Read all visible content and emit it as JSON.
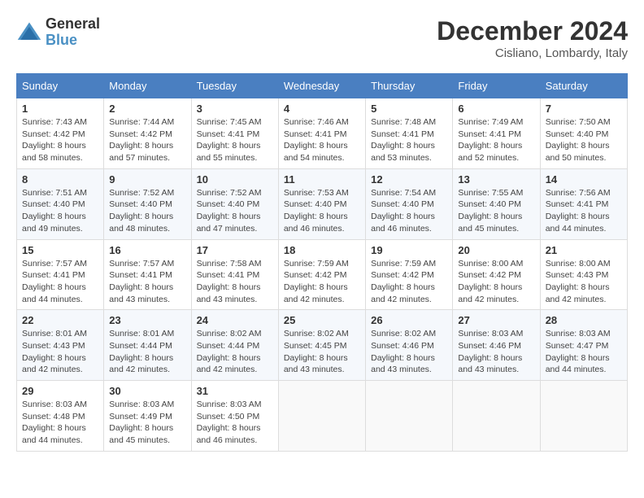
{
  "header": {
    "logo_general": "General",
    "logo_blue": "Blue",
    "title": "December 2024",
    "location": "Cisliano, Lombardy, Italy"
  },
  "calendar": {
    "days_of_week": [
      "Sunday",
      "Monday",
      "Tuesday",
      "Wednesday",
      "Thursday",
      "Friday",
      "Saturday"
    ],
    "weeks": [
      [
        {
          "day": "1",
          "sunrise": "7:43 AM",
          "sunset": "4:42 PM",
          "daylight": "8 hours and 58 minutes."
        },
        {
          "day": "2",
          "sunrise": "7:44 AM",
          "sunset": "4:42 PM",
          "daylight": "8 hours and 57 minutes."
        },
        {
          "day": "3",
          "sunrise": "7:45 AM",
          "sunset": "4:41 PM",
          "daylight": "8 hours and 55 minutes."
        },
        {
          "day": "4",
          "sunrise": "7:46 AM",
          "sunset": "4:41 PM",
          "daylight": "8 hours and 54 minutes."
        },
        {
          "day": "5",
          "sunrise": "7:48 AM",
          "sunset": "4:41 PM",
          "daylight": "8 hours and 53 minutes."
        },
        {
          "day": "6",
          "sunrise": "7:49 AM",
          "sunset": "4:41 PM",
          "daylight": "8 hours and 52 minutes."
        },
        {
          "day": "7",
          "sunrise": "7:50 AM",
          "sunset": "4:40 PM",
          "daylight": "8 hours and 50 minutes."
        }
      ],
      [
        {
          "day": "8",
          "sunrise": "7:51 AM",
          "sunset": "4:40 PM",
          "daylight": "8 hours and 49 minutes."
        },
        {
          "day": "9",
          "sunrise": "7:52 AM",
          "sunset": "4:40 PM",
          "daylight": "8 hours and 48 minutes."
        },
        {
          "day": "10",
          "sunrise": "7:52 AM",
          "sunset": "4:40 PM",
          "daylight": "8 hours and 47 minutes."
        },
        {
          "day": "11",
          "sunrise": "7:53 AM",
          "sunset": "4:40 PM",
          "daylight": "8 hours and 46 minutes."
        },
        {
          "day": "12",
          "sunrise": "7:54 AM",
          "sunset": "4:40 PM",
          "daylight": "8 hours and 46 minutes."
        },
        {
          "day": "13",
          "sunrise": "7:55 AM",
          "sunset": "4:40 PM",
          "daylight": "8 hours and 45 minutes."
        },
        {
          "day": "14",
          "sunrise": "7:56 AM",
          "sunset": "4:41 PM",
          "daylight": "8 hours and 44 minutes."
        }
      ],
      [
        {
          "day": "15",
          "sunrise": "7:57 AM",
          "sunset": "4:41 PM",
          "daylight": "8 hours and 44 minutes."
        },
        {
          "day": "16",
          "sunrise": "7:57 AM",
          "sunset": "4:41 PM",
          "daylight": "8 hours and 43 minutes."
        },
        {
          "day": "17",
          "sunrise": "7:58 AM",
          "sunset": "4:41 PM",
          "daylight": "8 hours and 43 minutes."
        },
        {
          "day": "18",
          "sunrise": "7:59 AM",
          "sunset": "4:42 PM",
          "daylight": "8 hours and 42 minutes."
        },
        {
          "day": "19",
          "sunrise": "7:59 AM",
          "sunset": "4:42 PM",
          "daylight": "8 hours and 42 minutes."
        },
        {
          "day": "20",
          "sunrise": "8:00 AM",
          "sunset": "4:42 PM",
          "daylight": "8 hours and 42 minutes."
        },
        {
          "day": "21",
          "sunrise": "8:00 AM",
          "sunset": "4:43 PM",
          "daylight": "8 hours and 42 minutes."
        }
      ],
      [
        {
          "day": "22",
          "sunrise": "8:01 AM",
          "sunset": "4:43 PM",
          "daylight": "8 hours and 42 minutes."
        },
        {
          "day": "23",
          "sunrise": "8:01 AM",
          "sunset": "4:44 PM",
          "daylight": "8 hours and 42 minutes."
        },
        {
          "day": "24",
          "sunrise": "8:02 AM",
          "sunset": "4:44 PM",
          "daylight": "8 hours and 42 minutes."
        },
        {
          "day": "25",
          "sunrise": "8:02 AM",
          "sunset": "4:45 PM",
          "daylight": "8 hours and 43 minutes."
        },
        {
          "day": "26",
          "sunrise": "8:02 AM",
          "sunset": "4:46 PM",
          "daylight": "8 hours and 43 minutes."
        },
        {
          "day": "27",
          "sunrise": "8:03 AM",
          "sunset": "4:46 PM",
          "daylight": "8 hours and 43 minutes."
        },
        {
          "day": "28",
          "sunrise": "8:03 AM",
          "sunset": "4:47 PM",
          "daylight": "8 hours and 44 minutes."
        }
      ],
      [
        {
          "day": "29",
          "sunrise": "8:03 AM",
          "sunset": "4:48 PM",
          "daylight": "8 hours and 44 minutes."
        },
        {
          "day": "30",
          "sunrise": "8:03 AM",
          "sunset": "4:49 PM",
          "daylight": "8 hours and 45 minutes."
        },
        {
          "day": "31",
          "sunrise": "8:03 AM",
          "sunset": "4:50 PM",
          "daylight": "8 hours and 46 minutes."
        },
        null,
        null,
        null,
        null
      ]
    ]
  }
}
